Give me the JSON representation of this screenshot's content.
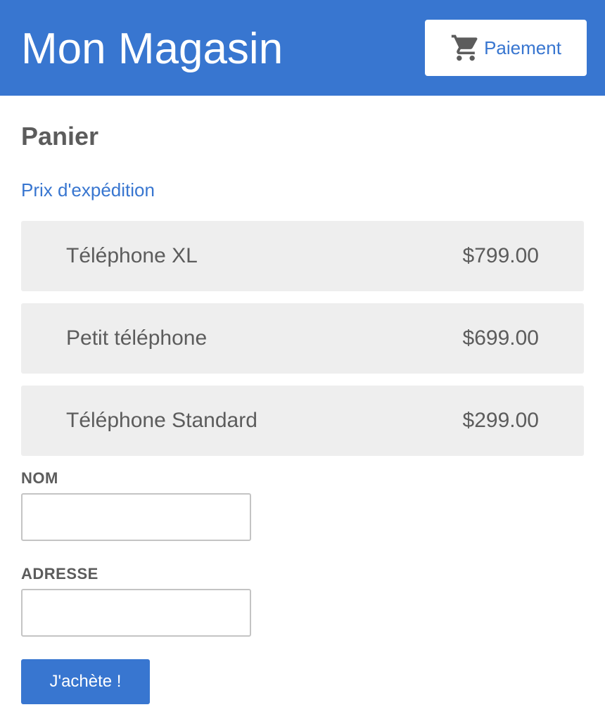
{
  "header": {
    "title": "Mon Magasin",
    "checkout_label": "Paiement",
    "checkout_icon": "shopping-cart-icon",
    "background_color": "#3876d0"
  },
  "cart": {
    "heading": "Panier",
    "shipping_link": "Prix d'expédition",
    "items": [
      {
        "name": "Téléphone XL",
        "price": "$799.00"
      },
      {
        "name": "Petit téléphone",
        "price": "$699.00"
      },
      {
        "name": "Téléphone Standard",
        "price": "$299.00"
      }
    ]
  },
  "form": {
    "name_label": "NOM",
    "name_value": "",
    "address_label": "ADRESSE",
    "address_value": "",
    "submit_label": "J'achète !"
  }
}
